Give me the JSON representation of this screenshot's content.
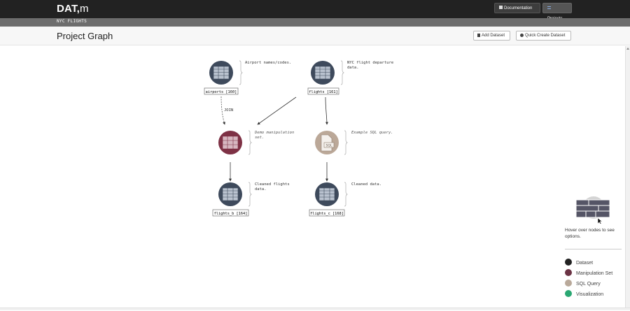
{
  "navbar": {
    "brand_main": "DAT,",
    "brand_sub": "m",
    "documentation_label": "Documentation",
    "projects_label": "Projects"
  },
  "breadcrumb": {
    "project": "NYC FLIGHTS"
  },
  "header": {
    "title": "Project Graph",
    "add_dataset_label": "Add Dataset",
    "quick_create_label": "Quick Create Dataset"
  },
  "graph": {
    "nodes": [
      {
        "id": "airports",
        "type": "dataset",
        "label": "airports [160]",
        "desc": [
          "Airport names/codes."
        ]
      },
      {
        "id": "flights",
        "type": "dataset",
        "label": "flights [161]",
        "desc": [
          "NYC flight departure",
          "data."
        ]
      },
      {
        "id": "manip",
        "type": "manipulation",
        "label": "",
        "desc": [
          "Demo manipulation",
          "set."
        ]
      },
      {
        "id": "sql",
        "type": "sql",
        "label": "",
        "desc": [
          "Example SQL query."
        ]
      },
      {
        "id": "flights_b",
        "type": "dataset",
        "label": "flights_b [164]",
        "desc": [
          "Cleaned flights",
          "data."
        ]
      },
      {
        "id": "flights_c",
        "type": "dataset",
        "label": "flights_c [168]",
        "desc": [
          "Cleaned data."
        ]
      }
    ],
    "edge_label_join": "JOIN",
    "sql_icon_text": "SQL"
  },
  "legend": {
    "hint": "Hover over nodes to see options.",
    "items": [
      {
        "label": "Dataset",
        "color": "#222222"
      },
      {
        "label": "Manipulation Set",
        "color": "#6b3344"
      },
      {
        "label": "SQL Query",
        "color": "#b9a99a"
      },
      {
        "label": "Visualization",
        "color": "#2aa772"
      }
    ]
  },
  "colors": {
    "dataset": "#3e4a5c",
    "manipulation": "#7e3145",
    "sql": "#bba898"
  }
}
